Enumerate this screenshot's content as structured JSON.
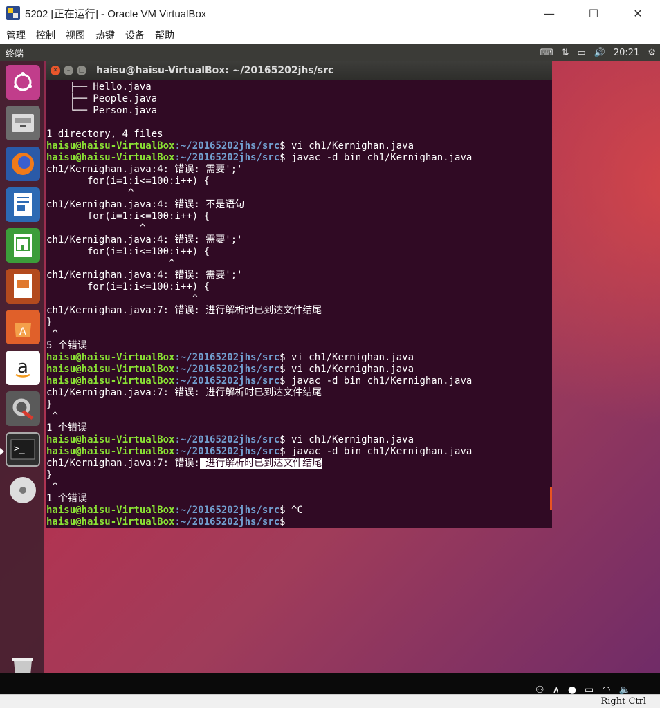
{
  "host": {
    "title": "5202 [正在运行] - Oracle VM VirtualBox",
    "controls": {
      "minimize": "—",
      "maximize": "☐",
      "close": "✕"
    },
    "menu": [
      "管理",
      "控制",
      "视图",
      "热键",
      "设备",
      "帮助"
    ],
    "status": {
      "host_key": "Right Ctrl"
    }
  },
  "panel": {
    "app_name": "终端",
    "time": "20:21",
    "icons": [
      "keyboard-icon",
      "network-icon",
      "battery-icon",
      "volume-icon",
      "gear-icon"
    ]
  },
  "launcher": [
    "ubuntu-dash-icon",
    "files-icon",
    "firefox-icon",
    "writer-icon",
    "calc-icon",
    "impress-icon",
    "software-center-icon",
    "amazon-icon",
    "system-settings-icon",
    "terminal-icon",
    "dvd-icon",
    "trash-icon"
  ],
  "terminal": {
    "title": "haisu@haisu-VirtualBox: ~/20165202jhs/src",
    "prompt_user": "haisu@haisu-VirtualBox",
    "prompt_path": ":~/20165202jhs/src",
    "lines": [
      {
        "t": "text",
        "s": "    ├── Hello.java"
      },
      {
        "t": "text",
        "s": "    ├── People.java"
      },
      {
        "t": "text",
        "s": "    └── Person.java"
      },
      {
        "t": "text",
        "s": ""
      },
      {
        "t": "text",
        "s": "1 directory, 4 files"
      },
      {
        "t": "cmd",
        "s": "$ vi ch1/Kernighan.java"
      },
      {
        "t": "cmd",
        "s": "$ javac -d bin ch1/Kernighan.java"
      },
      {
        "t": "text",
        "s": "ch1/Kernighan.java:4: 错误: 需要';'"
      },
      {
        "t": "text",
        "s": "       for(i=1:i<=100:i++) {"
      },
      {
        "t": "text",
        "s": "              ^"
      },
      {
        "t": "text",
        "s": "ch1/Kernighan.java:4: 错误: 不是语句"
      },
      {
        "t": "text",
        "s": "       for(i=1:i<=100:i++) {"
      },
      {
        "t": "text",
        "s": "                ^"
      },
      {
        "t": "text",
        "s": "ch1/Kernighan.java:4: 错误: 需要';'"
      },
      {
        "t": "text",
        "s": "       for(i=1:i<=100:i++) {"
      },
      {
        "t": "text",
        "s": "                     ^"
      },
      {
        "t": "text",
        "s": "ch1/Kernighan.java:4: 错误: 需要';'"
      },
      {
        "t": "text",
        "s": "       for(i=1:i<=100:i++) {"
      },
      {
        "t": "text",
        "s": "                         ^"
      },
      {
        "t": "text",
        "s": "ch1/Kernighan.java:7: 错误: 进行解析时已到达文件结尾"
      },
      {
        "t": "text",
        "s": "}"
      },
      {
        "t": "text",
        "s": " ^"
      },
      {
        "t": "text",
        "s": "5 个错误"
      },
      {
        "t": "cmd",
        "s": "$ vi ch1/Kernighan.java"
      },
      {
        "t": "cmd",
        "s": "$ vi ch1/Kernighan.java"
      },
      {
        "t": "cmd",
        "s": "$ javac -d bin ch1/Kernighan.java"
      },
      {
        "t": "text",
        "s": "ch1/Kernighan.java:7: 错误: 进行解析时已到达文件结尾"
      },
      {
        "t": "text",
        "s": "}"
      },
      {
        "t": "text",
        "s": " ^"
      },
      {
        "t": "text",
        "s": "1 个错误"
      },
      {
        "t": "cmd",
        "s": "$ vi ch1/Kernighan.java"
      },
      {
        "t": "cmd",
        "s": "$ javac -d bin ch1/Kernighan.java"
      },
      {
        "t": "hl",
        "s": "ch1/Kernighan.java:7: 错误:",
        "h": " 进行解析时已到达文件结尾"
      },
      {
        "t": "text",
        "s": "}"
      },
      {
        "t": "text",
        "s": " ^"
      },
      {
        "t": "text",
        "s": "1 个错误"
      },
      {
        "t": "cmd",
        "s": "$ ^C"
      },
      {
        "t": "cmd",
        "s": "$ "
      }
    ]
  }
}
